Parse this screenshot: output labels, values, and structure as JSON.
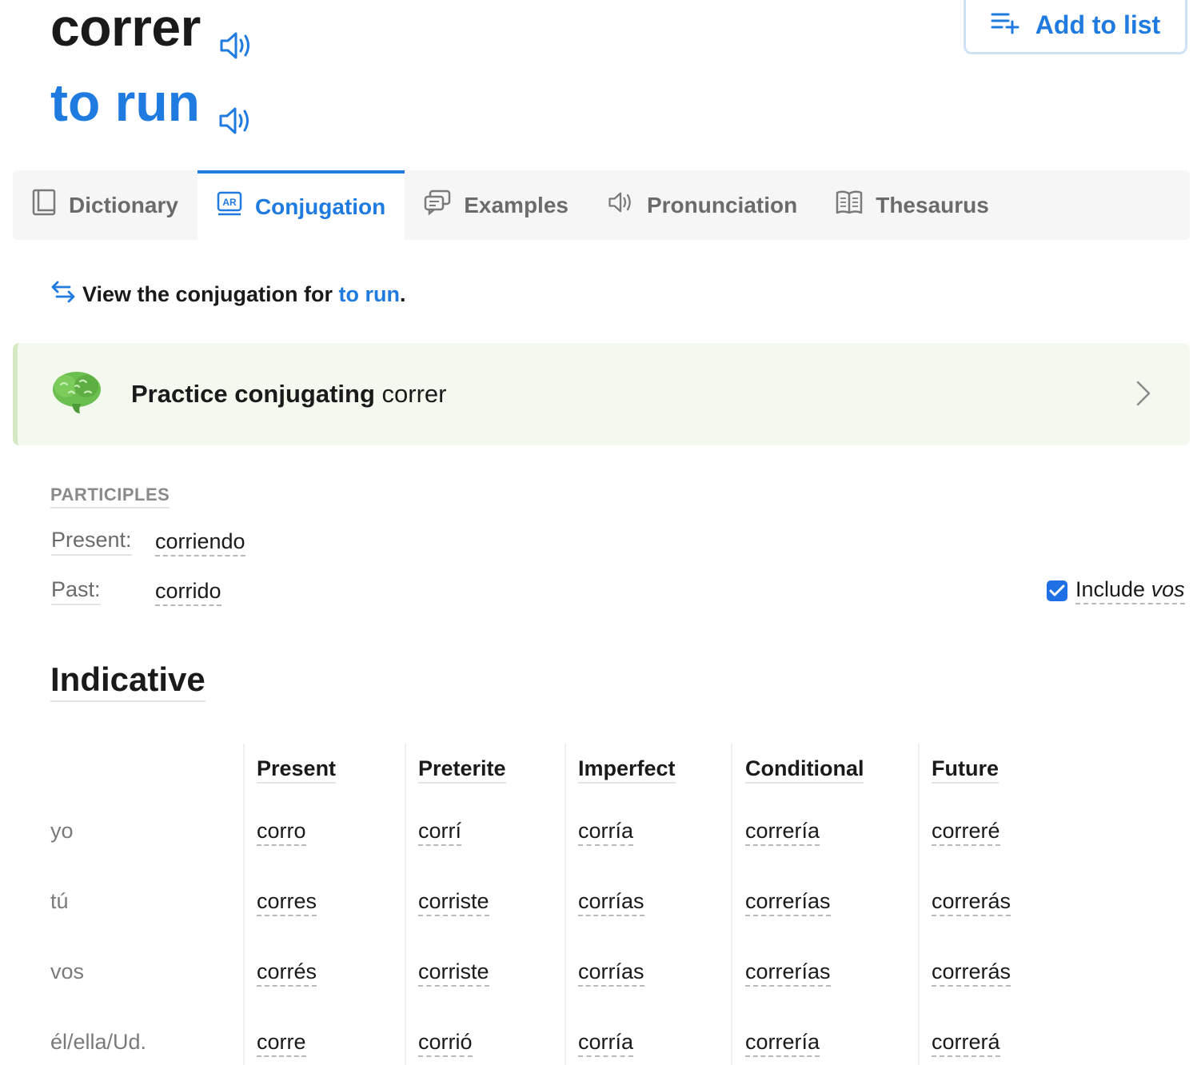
{
  "header": {
    "headword": "correr",
    "translation": "to run",
    "add_to_list_label": "Add to list"
  },
  "tabs": [
    {
      "label": "Dictionary",
      "active": false
    },
    {
      "label": "Conjugation",
      "active": true
    },
    {
      "label": "Examples",
      "active": false
    },
    {
      "label": "Pronunciation",
      "active": false
    },
    {
      "label": "Thesaurus",
      "active": false
    }
  ],
  "view_conjugation": {
    "prefix": "View the conjugation for ",
    "link": "to run",
    "suffix": "."
  },
  "practice": {
    "bold": "Practice conjugating",
    "verb": "correr"
  },
  "participles": {
    "title": "PARTICIPLES",
    "present_label": "Present:",
    "present_value": "corriendo",
    "past_label": "Past:",
    "past_value": "corrido"
  },
  "vos_toggle": {
    "checked": true,
    "label": "Include ",
    "label_italic": "vos"
  },
  "indicative": {
    "title": "Indicative",
    "columns": [
      "Present",
      "Preterite",
      "Imperfect",
      "Conditional",
      "Future"
    ],
    "rows": [
      {
        "pronoun": "yo",
        "forms": [
          "corro",
          "corrí",
          "corría",
          "correría",
          "correré"
        ]
      },
      {
        "pronoun": "tú",
        "forms": [
          "corres",
          "corriste",
          "corrías",
          "correrías",
          "correrás"
        ]
      },
      {
        "pronoun": "vos",
        "forms": [
          "corrés",
          "corriste",
          "corrías",
          "correrías",
          "correrás"
        ]
      },
      {
        "pronoun": "él/ella/Ud.",
        "forms": [
          "corre",
          "corrió",
          "corría",
          "correría",
          "correrá"
        ]
      }
    ]
  },
  "colors": {
    "accent": "#1f7be0",
    "practice_bg": "#f4f9f0",
    "tab_bar_bg": "#f6f6f6"
  }
}
